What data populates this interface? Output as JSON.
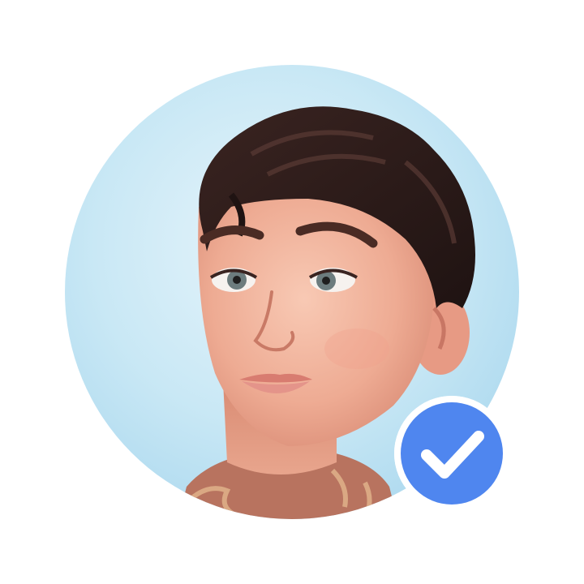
{
  "profile": {
    "avatar_icon": "avatar-illustration",
    "background_color": "#ffffff",
    "avatar_backdrop_color": "#bfe3f2"
  },
  "badge": {
    "icon": "verified-check-icon",
    "color": "#4f86ef",
    "check_color": "#ffffff",
    "ring_color": "#ffffff"
  }
}
